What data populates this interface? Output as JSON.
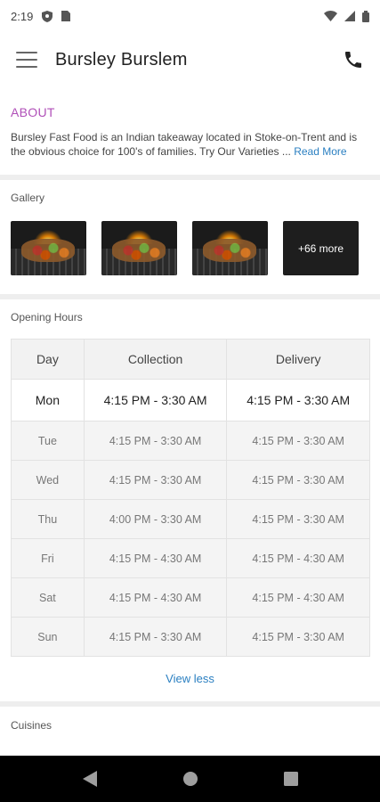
{
  "status": {
    "time": "2:19"
  },
  "app": {
    "title": "Bursley Burslem"
  },
  "about": {
    "heading": "ABOUT",
    "text": "Bursley Fast Food is an Indian takeaway located in Stoke-on-Trent and is the obvious choice for 100's of families. Try Our Varieties ... ",
    "read_more": "Read More"
  },
  "gallery": {
    "title": "Gallery",
    "more_label": "+66 more"
  },
  "hours": {
    "title": "Opening Hours",
    "headers": [
      "Day",
      "Collection",
      "Delivery"
    ],
    "rows": [
      {
        "day": "Mon",
        "collection": "4:15 PM - 3:30 AM",
        "delivery": "4:15 PM - 3:30 AM"
      },
      {
        "day": "Tue",
        "collection": "4:15 PM - 3:30 AM",
        "delivery": "4:15 PM - 3:30 AM"
      },
      {
        "day": "Wed",
        "collection": "4:15 PM - 3:30 AM",
        "delivery": "4:15 PM - 3:30 AM"
      },
      {
        "day": "Thu",
        "collection": "4:00 PM - 3:30 AM",
        "delivery": "4:15 PM - 3:30 AM"
      },
      {
        "day": "Fri",
        "collection": "4:15 PM - 4:30 AM",
        "delivery": "4:15 PM - 4:30 AM"
      },
      {
        "day": "Sat",
        "collection": "4:15 PM - 4:30 AM",
        "delivery": "4:15 PM - 4:30 AM"
      },
      {
        "day": "Sun",
        "collection": "4:15 PM - 3:30 AM",
        "delivery": "4:15 PM - 3:30 AM"
      }
    ],
    "view_less": "View less"
  },
  "cuisines": {
    "title": "Cuisines"
  },
  "colors": {
    "accent": "#b04fb8",
    "link": "#2a7fc1"
  },
  "icons": [
    "menu-icon",
    "phone-icon",
    "shield-icon",
    "sim-card-icon",
    "wifi-icon",
    "signal-icon",
    "battery-icon",
    "back-icon",
    "home-icon",
    "recents-icon"
  ]
}
